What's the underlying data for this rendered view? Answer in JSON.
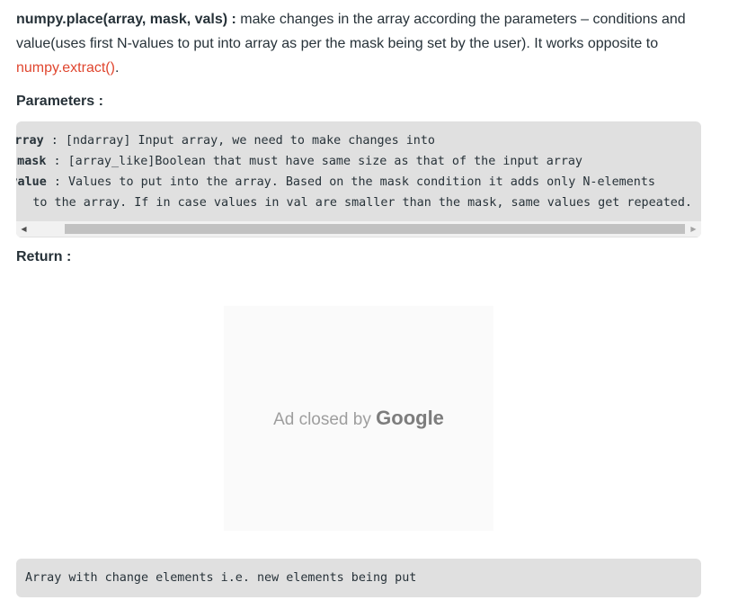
{
  "intro": {
    "signature": "numpy.place(array, mask, vals) :",
    "description": " make changes in the array according the parameters – conditions and value(uses first N-values to put into array as per the mask being set by the user). It works opposite to ",
    "link_text": "numpy.extract()",
    "trailing": "."
  },
  "headings": {
    "parameters": "Parameters :",
    "return": "Return :"
  },
  "parameters": [
    {
      "name": "array",
      "desc": " : [ndarray] Input array, we need to make changes into"
    },
    {
      "name": "mask",
      "desc": " : [array_like]Boolean that must have same size as that of the input array"
    },
    {
      "name": "value",
      "desc": " : Values to put into the array. Based on the mask condition it adds only N-elements"
    },
    {
      "name": "",
      "desc": "to the array. If in case values in val are smaller than the mask, same values get repeated."
    }
  ],
  "scrollbar": {
    "left_arrow": "◀",
    "right_arrow": "▶"
  },
  "ad": {
    "prefix": "Ad closed by ",
    "brand": "Google"
  },
  "return_value": "Array with change elements i.e. new elements being put"
}
